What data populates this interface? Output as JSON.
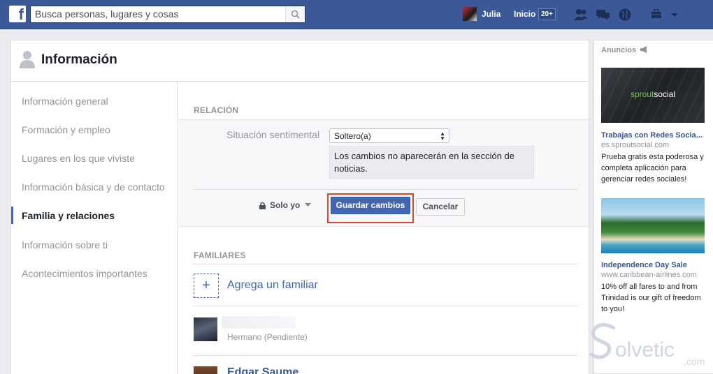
{
  "topbar": {
    "logo_letter": "f",
    "search_placeholder": "Busca personas, lugares y cosas",
    "user_name": "Julia",
    "home_label": "Inicio",
    "home_badge": "20+"
  },
  "profile": {
    "section_title": "Información"
  },
  "sidenav": {
    "items": [
      {
        "label": "Información general",
        "active": false
      },
      {
        "label": "Formación y empleo",
        "active": false
      },
      {
        "label": "Lugares en los que viviste",
        "active": false
      },
      {
        "label": "Información básica y de contacto",
        "active": false
      },
      {
        "label": "Familia y relaciones",
        "active": true
      },
      {
        "label": "Información sobre ti",
        "active": false
      },
      {
        "label": "Acontecimientos importantes",
        "active": false
      }
    ]
  },
  "relation": {
    "heading": "RELACIÓN",
    "field_label": "Situación sentimental",
    "select_value": "Soltero(a)",
    "note": "Los cambios no aparecerán en la sección de noticias.",
    "privacy_label": "Solo yo",
    "save_label": "Guardar cambios",
    "cancel_label": "Cancelar"
  },
  "family": {
    "heading": "FAMILIARES",
    "add_symbol": "+",
    "add_label": "Agrega un familiar",
    "members": [
      {
        "status": "Hermano (Pendiente)"
      },
      {
        "name": "Edgar Saume"
      }
    ]
  },
  "ads": {
    "heading": "Anuncios",
    "items": [
      {
        "brand_a": "sprout",
        "brand_b": "social",
        "title": "Trabajas con Redes Socia...",
        "url": "es.sproutsocial.com",
        "body": "Prueba gratis esta poderosa y completa aplicación para gerenciar redes sociales!"
      },
      {
        "title": "Independence Day Sale",
        "url": "www.caribbean-airlines.com",
        "body": "10% off all fares to and from Trinidad is our gift of freedom to you!"
      }
    ]
  },
  "watermark": {
    "text": "olvetic",
    "suffix": ".com"
  },
  "colors": {
    "brand": "#3b5998",
    "button": "#4267b2",
    "highlight": "#e0452f"
  }
}
